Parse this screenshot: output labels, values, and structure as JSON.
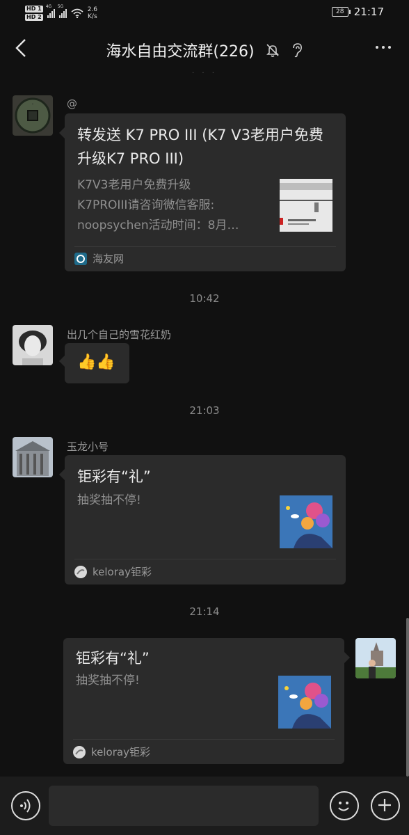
{
  "status_bar": {
    "hd1": "HD 1",
    "hd2": "HD 2",
    "sig1_tag": "4G",
    "sig2_tag": "5G",
    "speed_value": "2.6",
    "speed_unit": "K/s",
    "battery": "28",
    "time": "21:17"
  },
  "header": {
    "title": "海水自由交流群(226)",
    "icons": [
      "back-icon",
      "mute-bell-icon",
      "earpiece-icon",
      "more-icon"
    ]
  },
  "messages": [
    {
      "type": "link_card",
      "side": "left",
      "nickname": "@",
      "avatar_icon": "coin-avatar",
      "title": "转发送 K7 PRO III (K7 V3老用户免费升级K7 PRO III)",
      "desc_lines": [
        "K7V3老用户免费升级",
        "K7PROIII请咨询微信客服:",
        "noopsychen活动时间：8月…"
      ],
      "thumb_icon": "document-thumbnail",
      "source": "海友网",
      "source_icon": "haiyou-logo"
    },
    {
      "type": "time",
      "text": "10:42"
    },
    {
      "type": "text",
      "side": "left",
      "nickname": "出几个自己的雪花红奶",
      "avatar_icon": "portrait-avatar",
      "content": "👍👍"
    },
    {
      "type": "time",
      "text": "21:03"
    },
    {
      "type": "link_card",
      "side": "left",
      "nickname": "玉龙小号",
      "avatar_icon": "building-avatar",
      "title": "钜彩有“礼”",
      "desc_lines": [
        "抽奖抽不停!"
      ],
      "thumb_icon": "coral-reef-thumbnail",
      "source": "keloray钜彩",
      "source_icon": "keloray-logo"
    },
    {
      "type": "time",
      "text": "21:14"
    },
    {
      "type": "link_card",
      "side": "right",
      "avatar_icon": "self-avatar",
      "title": "钜彩有“礼”",
      "desc_lines": [
        "抽奖抽不停!"
      ],
      "thumb_icon": "coral-reef-thumbnail",
      "source": "keloray钜彩",
      "source_icon": "keloray-logo"
    }
  ],
  "input_bar": {
    "placeholder": "",
    "icons": [
      "voice-icon",
      "emoji-icon",
      "plus-icon"
    ]
  },
  "colors": {
    "background": "#111111",
    "bubble": "#2b2b2b",
    "input_bar": "#1c1c1c",
    "secondary_text": "#8f8f8f"
  }
}
